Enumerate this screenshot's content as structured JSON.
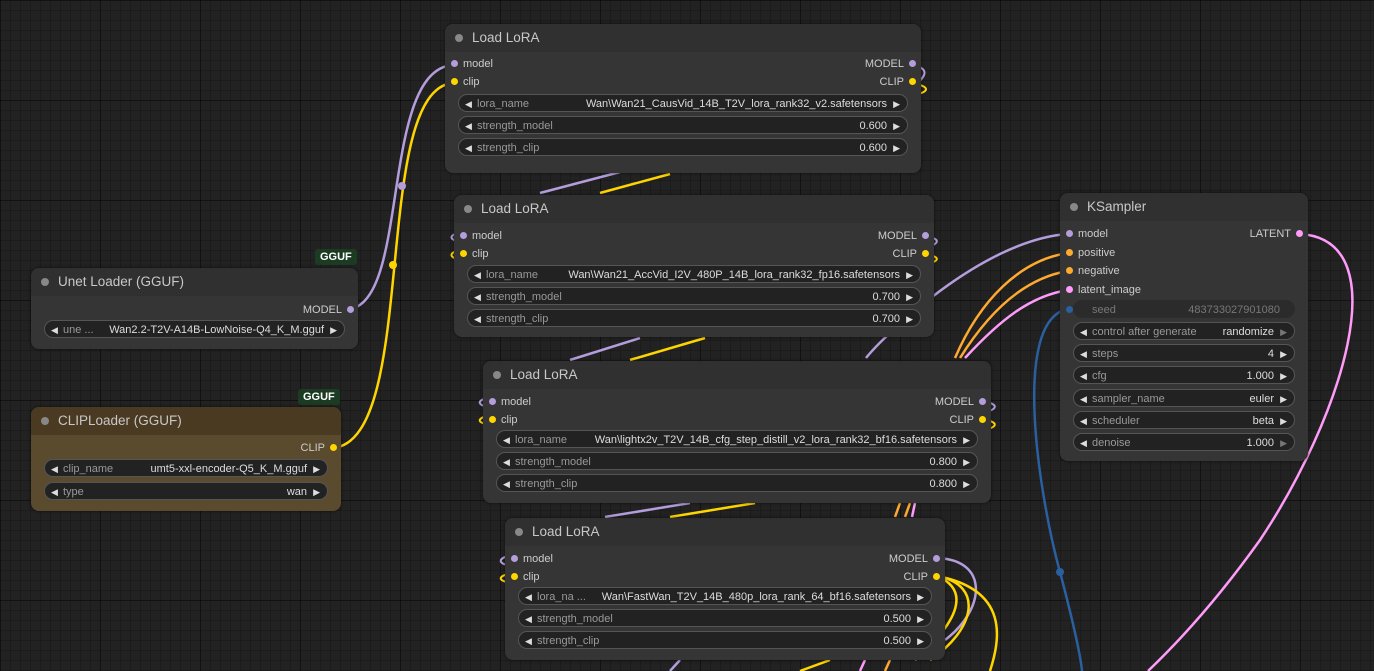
{
  "unet_loader": {
    "badge": "GGUF",
    "title": "Unet Loader (GGUF)",
    "output": "MODEL",
    "widget_label": "une ...",
    "widget_value": "Wan2.2-T2V-A14B-LowNoise-Q4_K_M.gguf"
  },
  "clip_loader": {
    "badge": "GGUF",
    "title": "CLIPLoader (GGUF)",
    "output": "CLIP",
    "widgets": [
      {
        "label": "clip_name",
        "value": "umt5-xxl-encoder-Q5_K_M.gguf"
      },
      {
        "label": "type",
        "value": "wan"
      }
    ]
  },
  "lora_nodes": [
    {
      "title": "Load LoRA",
      "inputs": [
        "model",
        "clip"
      ],
      "outputs": [
        "MODEL",
        "CLIP"
      ],
      "widgets": [
        {
          "label": "lora_name",
          "value": "Wan\\Wan21_CausVid_14B_T2V_lora_rank32_v2.safetensors"
        },
        {
          "label": "strength_model",
          "value": "0.600"
        },
        {
          "label": "strength_clip",
          "value": "0.600"
        }
      ]
    },
    {
      "title": "Load LoRA",
      "inputs": [
        "model",
        "clip"
      ],
      "outputs": [
        "MODEL",
        "CLIP"
      ],
      "widgets": [
        {
          "label": "lora_name",
          "value": "Wan\\Wan21_AccVid_I2V_480P_14B_lora_rank32_fp16.safetensors"
        },
        {
          "label": "strength_model",
          "value": "0.700"
        },
        {
          "label": "strength_clip",
          "value": "0.700"
        }
      ]
    },
    {
      "title": "Load LoRA",
      "inputs": [
        "model",
        "clip"
      ],
      "outputs": [
        "MODEL",
        "CLIP"
      ],
      "widgets": [
        {
          "label": "lora_name",
          "value": "Wan\\lightx2v_T2V_14B_cfg_step_distill_v2_lora_rank32_bf16.safetensors"
        },
        {
          "label": "strength_model",
          "value": "0.800"
        },
        {
          "label": "strength_clip",
          "value": "0.800"
        }
      ]
    },
    {
      "title": "Load LoRA",
      "inputs": [
        "model",
        "clip"
      ],
      "outputs": [
        "MODEL",
        "CLIP"
      ],
      "widgets": [
        {
          "label": "lora_na ...",
          "value": "Wan\\FastWan_T2V_14B_480p_lora_rank_64_bf16.safetensors"
        },
        {
          "label": "strength_model",
          "value": "0.500"
        },
        {
          "label": "strength_clip",
          "value": "0.500"
        }
      ]
    }
  ],
  "ksampler": {
    "title": "KSampler",
    "inputs": [
      "model",
      "positive",
      "negative",
      "latent_image"
    ],
    "output": "LATENT",
    "seed_label": "seed",
    "seed_value": "483733027901080",
    "widgets": [
      {
        "label": "control after generate",
        "value": "randomize"
      },
      {
        "label": "steps",
        "value": "4"
      },
      {
        "label": "cfg",
        "value": "1.000"
      },
      {
        "label": "sampler_name",
        "value": "euler"
      },
      {
        "label": "scheduler",
        "value": "beta"
      },
      {
        "label": "denoise",
        "value": "1.000"
      }
    ]
  },
  "colors": {
    "model": "#b39ddb",
    "clip": "#ffd500",
    "conditioning": "#ffa931",
    "latent": "#ff9cf9",
    "int": "#2a5fa0"
  }
}
